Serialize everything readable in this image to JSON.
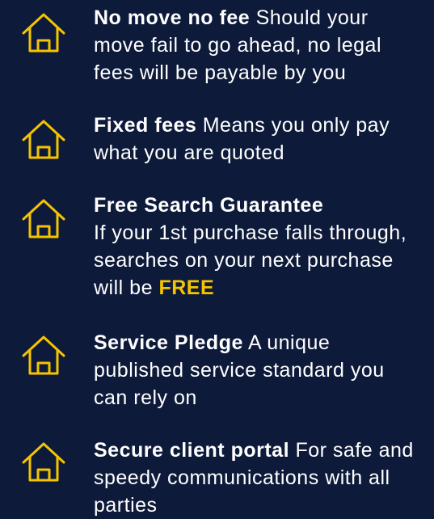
{
  "features": [
    {
      "icon": "house-icon",
      "title": "No move no fee",
      "description": "Should your move fail to go ahead, no legal fees will be payable by you"
    },
    {
      "icon": "house-icon",
      "title": "Fixed fees",
      "description": "Means you only pay what you are quoted"
    },
    {
      "icon": "house-icon",
      "title": "Free Search Guarantee",
      "description": "If your 1st purchase falls through, searches on your next purchase will be",
      "highlight": "FREE"
    },
    {
      "icon": "house-icon",
      "title": "Service Pledge",
      "description": "A unique published service standard you can rely on"
    },
    {
      "icon": "house-icon",
      "title": "Secure client portal",
      "description": "For safe and speedy communications with all parties"
    }
  ],
  "colors": {
    "background": "#0d1a3a",
    "accent": "#f5c400",
    "text": "#ffffff"
  }
}
